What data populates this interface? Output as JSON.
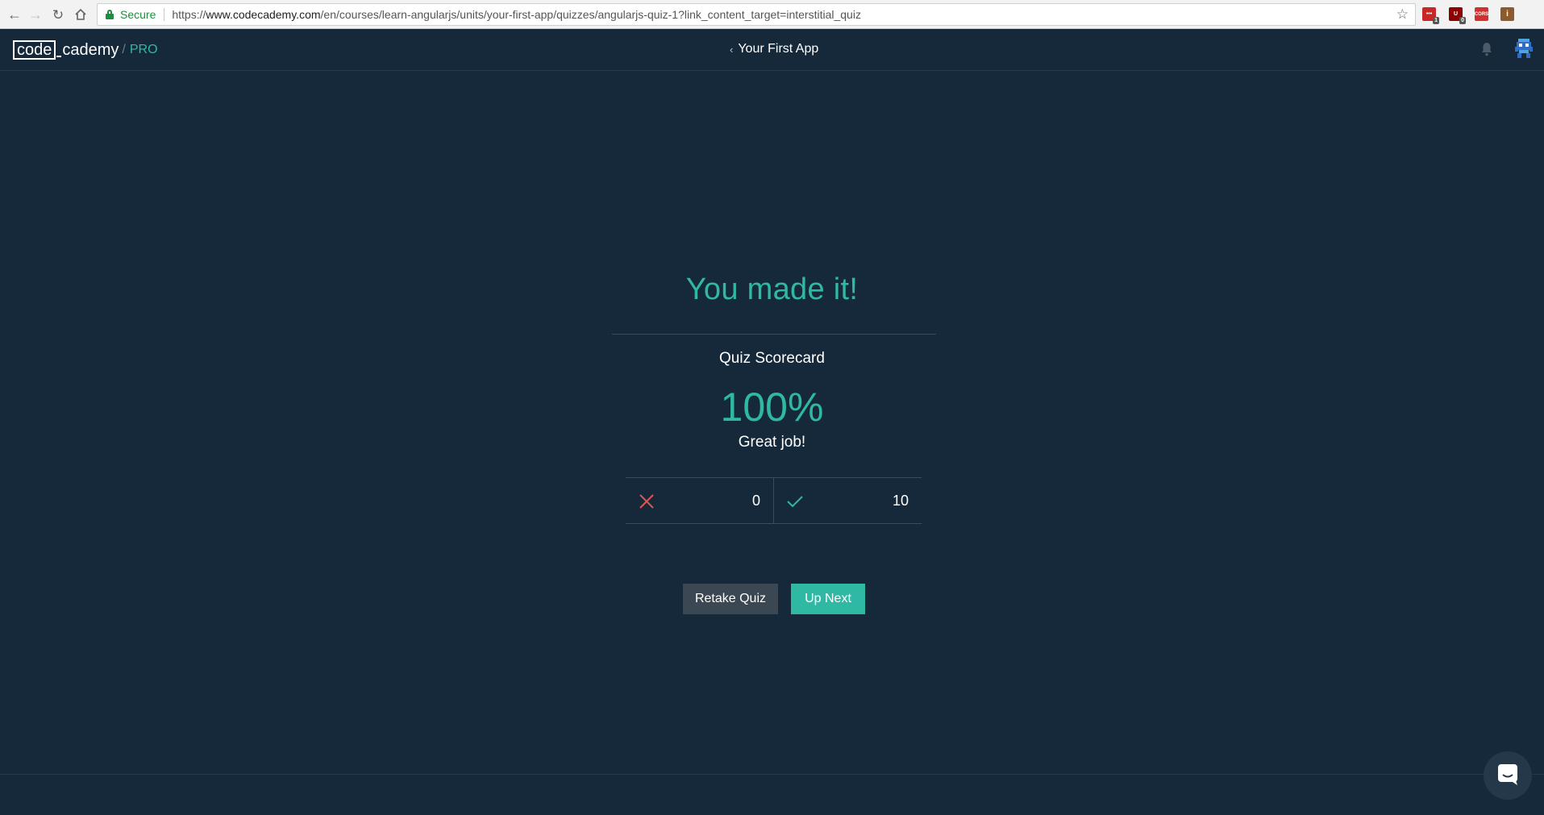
{
  "browser": {
    "secure_label": "Secure",
    "url_scheme": "https://",
    "url_host": "www.codecademy.com",
    "url_path": "/en/courses/learn-angularjs/units/your-first-app/quizzes/angularjs-quiz-1?link_content_target=interstitial_quiz",
    "extensions": [
      {
        "label": "•••",
        "badge": "1",
        "color": "#c62828"
      },
      {
        "label": "U",
        "badge": "0",
        "color": "#8b0000"
      },
      {
        "label": "CORS",
        "badge": "",
        "color": "#d32f2f"
      },
      {
        "label": "i",
        "badge": "",
        "color": "#8d5a2b"
      }
    ]
  },
  "header": {
    "logo_boxed": "code",
    "logo_rest": "cademy",
    "logo_slash": "/",
    "logo_pro": "PRO",
    "title": "Your First App",
    "back_chevron": "‹"
  },
  "quiz": {
    "headline": "You made it!",
    "scorecard_title": "Quiz Scorecard",
    "score": "100%",
    "feedback": "Great job!",
    "incorrect": "0",
    "correct": "10",
    "retake_label": "Retake Quiz",
    "next_label": "Up Next"
  },
  "colors": {
    "background": "#15293a",
    "accent": "#2fb8a4",
    "incorrect": "#e0544f",
    "correct": "#2fb8a4"
  }
}
